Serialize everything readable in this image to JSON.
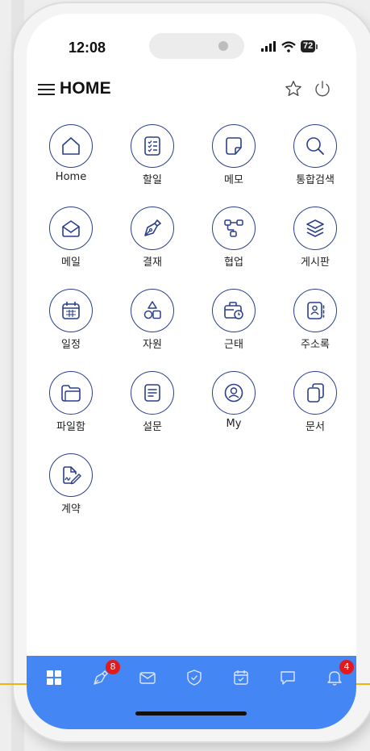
{
  "status_bar": {
    "time": "12:08",
    "battery": "72"
  },
  "header": {
    "title": "HOME"
  },
  "apps": [
    {
      "label": "Home",
      "icon": "house-icon"
    },
    {
      "label": "할일",
      "icon": "checklist-icon"
    },
    {
      "label": "메모",
      "icon": "note-icon"
    },
    {
      "label": "통합검색",
      "icon": "search-icon"
    },
    {
      "label": "메일",
      "icon": "mail-open-icon"
    },
    {
      "label": "결재",
      "icon": "pen-nib-icon"
    },
    {
      "label": "협업",
      "icon": "flowchart-icon"
    },
    {
      "label": "게시판",
      "icon": "layers-icon"
    },
    {
      "label": "일정",
      "icon": "calendar-icon"
    },
    {
      "label": "자원",
      "icon": "shapes-icon"
    },
    {
      "label": "근태",
      "icon": "briefcase-clock-icon"
    },
    {
      "label": "주소록",
      "icon": "address-book-icon"
    },
    {
      "label": "파일함",
      "icon": "folder-icon"
    },
    {
      "label": "설문",
      "icon": "document-lines-icon"
    },
    {
      "label": "My",
      "icon": "user-circle-icon"
    },
    {
      "label": "문서",
      "icon": "copy-icon"
    },
    {
      "label": "계약",
      "icon": "contract-sign-icon"
    }
  ],
  "tabbar": {
    "approval_badge": "8",
    "notification_badge": "4"
  },
  "colors": {
    "accent": "#4486f4",
    "icon_stroke": "#2b3f8c",
    "badge": "#e3191b",
    "line": "#f3b313"
  }
}
